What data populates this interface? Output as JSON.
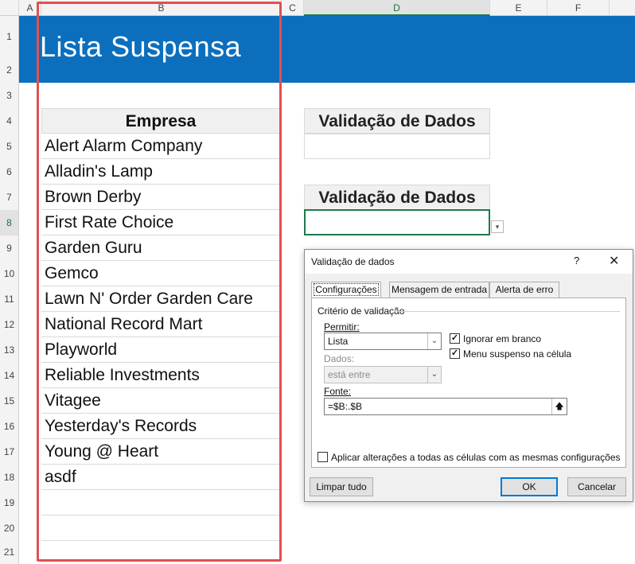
{
  "sheet": {
    "columns": [
      "A",
      "B",
      "C",
      "D",
      "E",
      "F"
    ],
    "rows": [
      "1",
      "2",
      "3",
      "4",
      "5",
      "6",
      "7",
      "8",
      "9",
      "10",
      "11",
      "12",
      "13",
      "14",
      "15",
      "16",
      "17",
      "18",
      "19",
      "20",
      "21"
    ],
    "title": "Lista Suspensa",
    "b_header": "Empresa",
    "companies": [
      "Alert Alarm Company",
      "Alladin's Lamp",
      "Brown Derby",
      "First Rate Choice",
      "Garden Guru",
      "Gemco",
      "Lawn N' Order Garden Care",
      "National Record Mart",
      "Playworld",
      "Reliable Investments",
      "Vitagee",
      "Yesterday's Records",
      "Young @ Heart",
      "asdf",
      "",
      "",
      ""
    ],
    "d_header_1": "Validação de Dados",
    "d_header_2": "Validação de Dados",
    "d_value_1": "",
    "d_value_2": "",
    "dropdown_arrow": "▾"
  },
  "dialog": {
    "title": "Validação de dados",
    "help": "?",
    "close": "✕",
    "tabs": [
      "Configurações",
      "Mensagem de entrada",
      "Alerta de erro"
    ],
    "group_label": "Critério de validação",
    "permitir_label": "Permitir:",
    "permitir_value": "Lista",
    "dados_label": "Dados:",
    "dados_value": "está entre",
    "ignorar_label": "Ignorar em branco",
    "ignorar_checked": true,
    "menu_label": "Menu suspenso na célula",
    "menu_checked": true,
    "fonte_label": "Fonte:",
    "fonte_value": "=$B:.$B",
    "apply_label": "Aplicar alterações a todas as células com as mesmas configurações",
    "apply_checked": false,
    "clear_button": "Limpar tudo",
    "ok_button": "OK",
    "cancel_button": "Cancelar"
  },
  "colors": {
    "title_band": "#0b6fbe",
    "selection_frame": "#e05050",
    "active_cell": "#1f7a4a"
  }
}
